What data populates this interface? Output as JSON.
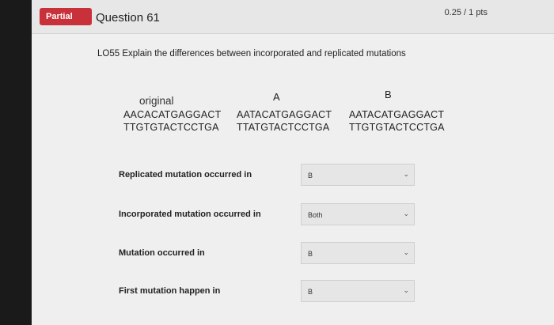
{
  "header": {
    "status_badge": "Partial",
    "question_title": "Question 61",
    "points": "0.25 / 1 pts"
  },
  "prompt": "LO55 Explain the differences between incorporated and replicated mutations",
  "sequences": {
    "original_label": "original",
    "original_top": "AACACATGAGGACT",
    "original_bottom": "TTGTGTACTCCTGA",
    "a_label": "A",
    "a_top": "AATACATGAGGACT",
    "a_bottom": "TTATGTACTCCTGA",
    "b_label": "B",
    "b_top": "AATACATGAGGACT",
    "b_bottom": "TTGTGTACTCCTGA"
  },
  "rows": [
    {
      "question": "Replicated mutation occurred in",
      "selected": "B"
    },
    {
      "question": "Incorporated mutation occurred in",
      "selected": "Both"
    },
    {
      "question": "Mutation occurred in",
      "selected": "B"
    },
    {
      "question": "First mutation happen in",
      "selected": "B"
    }
  ],
  "icons": {
    "dropdown": "chevron-down-icon"
  },
  "colors": {
    "badge": "#c9313a"
  }
}
